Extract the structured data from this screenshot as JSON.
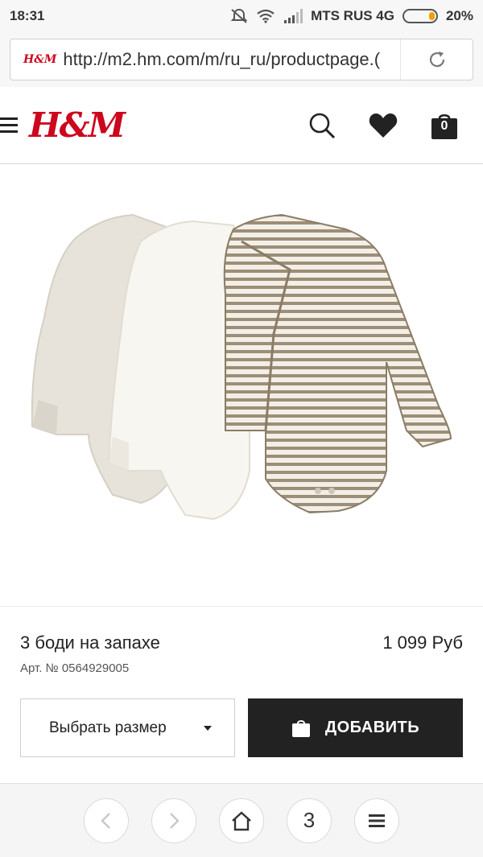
{
  "status_bar": {
    "time": "18:31",
    "carrier": "MTS RUS 4G",
    "battery": "20%",
    "battery_level": 0.2
  },
  "browser": {
    "url": "http://m2.hm.com/m/ru_ru/productpage.(",
    "favicon_text": "H&M"
  },
  "header": {
    "logo": "H&M",
    "bag_count": "0"
  },
  "product": {
    "name": "3 боди на запахе",
    "price": "1 099 Руб",
    "article": "Арт. № 0564929005",
    "size_label": "Выбрать размер",
    "add_label": "ДОБАВИТЬ"
  },
  "bottom_nav": {
    "tabs_count": "3"
  },
  "colors": {
    "brand_red": "#cc071e",
    "button_dark": "#222222",
    "battery_orange": "#f0a000"
  }
}
